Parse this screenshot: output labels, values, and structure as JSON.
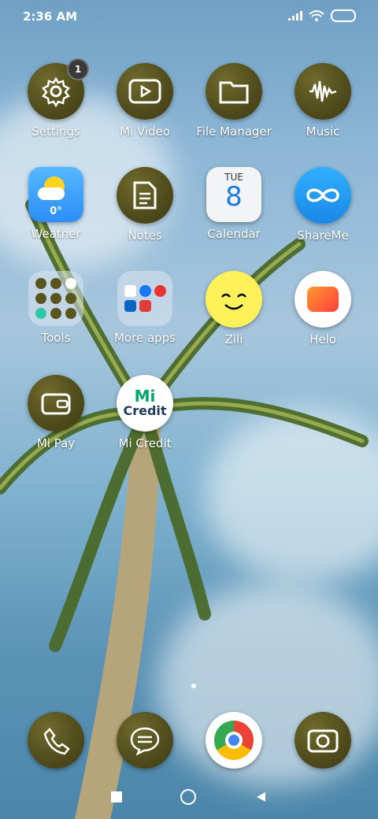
{
  "status": {
    "time": "2:36 AM"
  },
  "apps": [
    {
      "label": "Settings",
      "badge": "1"
    },
    {
      "label": "Mi Video"
    },
    {
      "label": "File Manager"
    },
    {
      "label": "Music"
    },
    {
      "label": "Weather",
      "value": "0°"
    },
    {
      "label": "Notes"
    },
    {
      "label": "Calendar",
      "day": "TUE",
      "date": "8"
    },
    {
      "label": "ShareMe"
    },
    {
      "label": "Tools"
    },
    {
      "label": "More apps"
    },
    {
      "label": "Zili"
    },
    {
      "label": "Helo"
    },
    {
      "label": "Mi Pay"
    },
    {
      "label": "Mi Credit",
      "logo_top": "Mi",
      "logo_bottom": "Credit"
    }
  ],
  "colors": {
    "accent_olive": "#4f4b1c",
    "weather": "#3aa0ff",
    "calendar_date": "#1f7ae0",
    "shareme": "#1a9ee6"
  }
}
